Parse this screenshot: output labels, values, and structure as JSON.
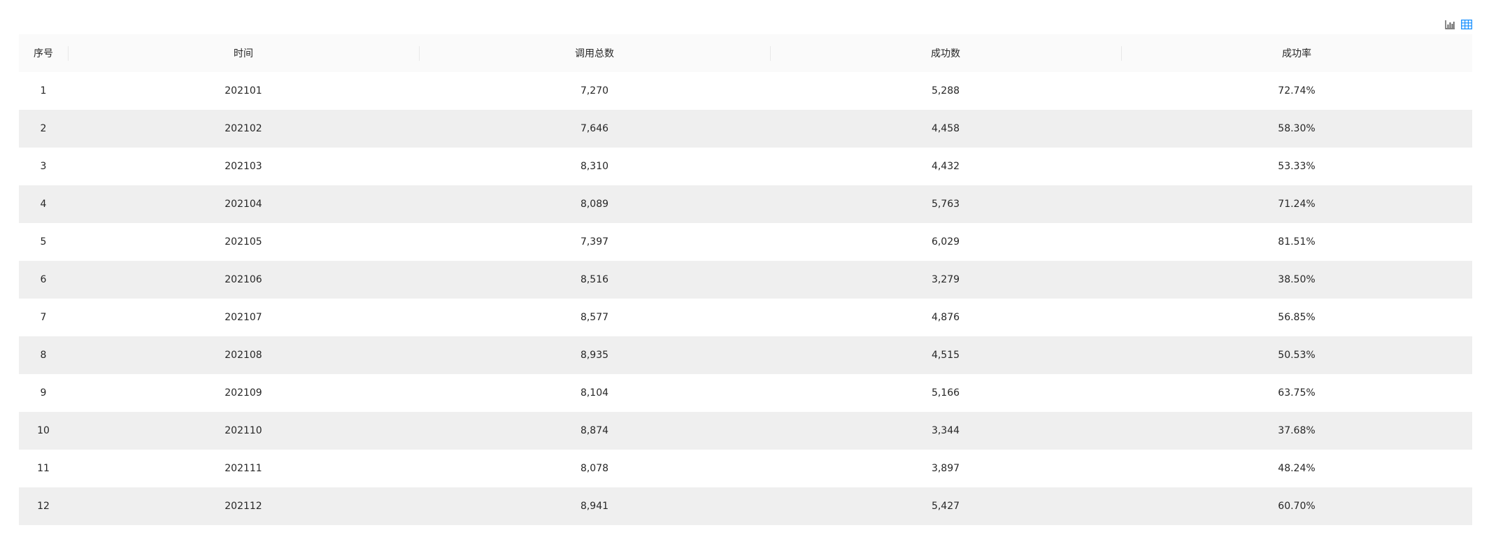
{
  "toolbar": {
    "chart_view_icon": "bar-chart-icon",
    "table_view_icon": "table-icon",
    "accent_color": "#1890ff"
  },
  "table": {
    "headers": [
      "序号",
      "时间",
      "调用总数",
      "成功数",
      "成功率"
    ],
    "rows": [
      [
        "1",
        "202101",
        "7,270",
        "5,288",
        "72.74%"
      ],
      [
        "2",
        "202102",
        "7,646",
        "4,458",
        "58.30%"
      ],
      [
        "3",
        "202103",
        "8,310",
        "4,432",
        "53.33%"
      ],
      [
        "4",
        "202104",
        "8,089",
        "5,763",
        "71.24%"
      ],
      [
        "5",
        "202105",
        "7,397",
        "6,029",
        "81.51%"
      ],
      [
        "6",
        "202106",
        "8,516",
        "3,279",
        "38.50%"
      ],
      [
        "7",
        "202107",
        "8,577",
        "4,876",
        "56.85%"
      ],
      [
        "8",
        "202108",
        "8,935",
        "4,515",
        "50.53%"
      ],
      [
        "9",
        "202109",
        "8,104",
        "5,166",
        "63.75%"
      ],
      [
        "10",
        "202110",
        "8,874",
        "3,344",
        "37.68%"
      ],
      [
        "11",
        "202111",
        "8,078",
        "3,897",
        "48.24%"
      ],
      [
        "12",
        "202112",
        "8,941",
        "5,427",
        "60.70%"
      ]
    ]
  }
}
